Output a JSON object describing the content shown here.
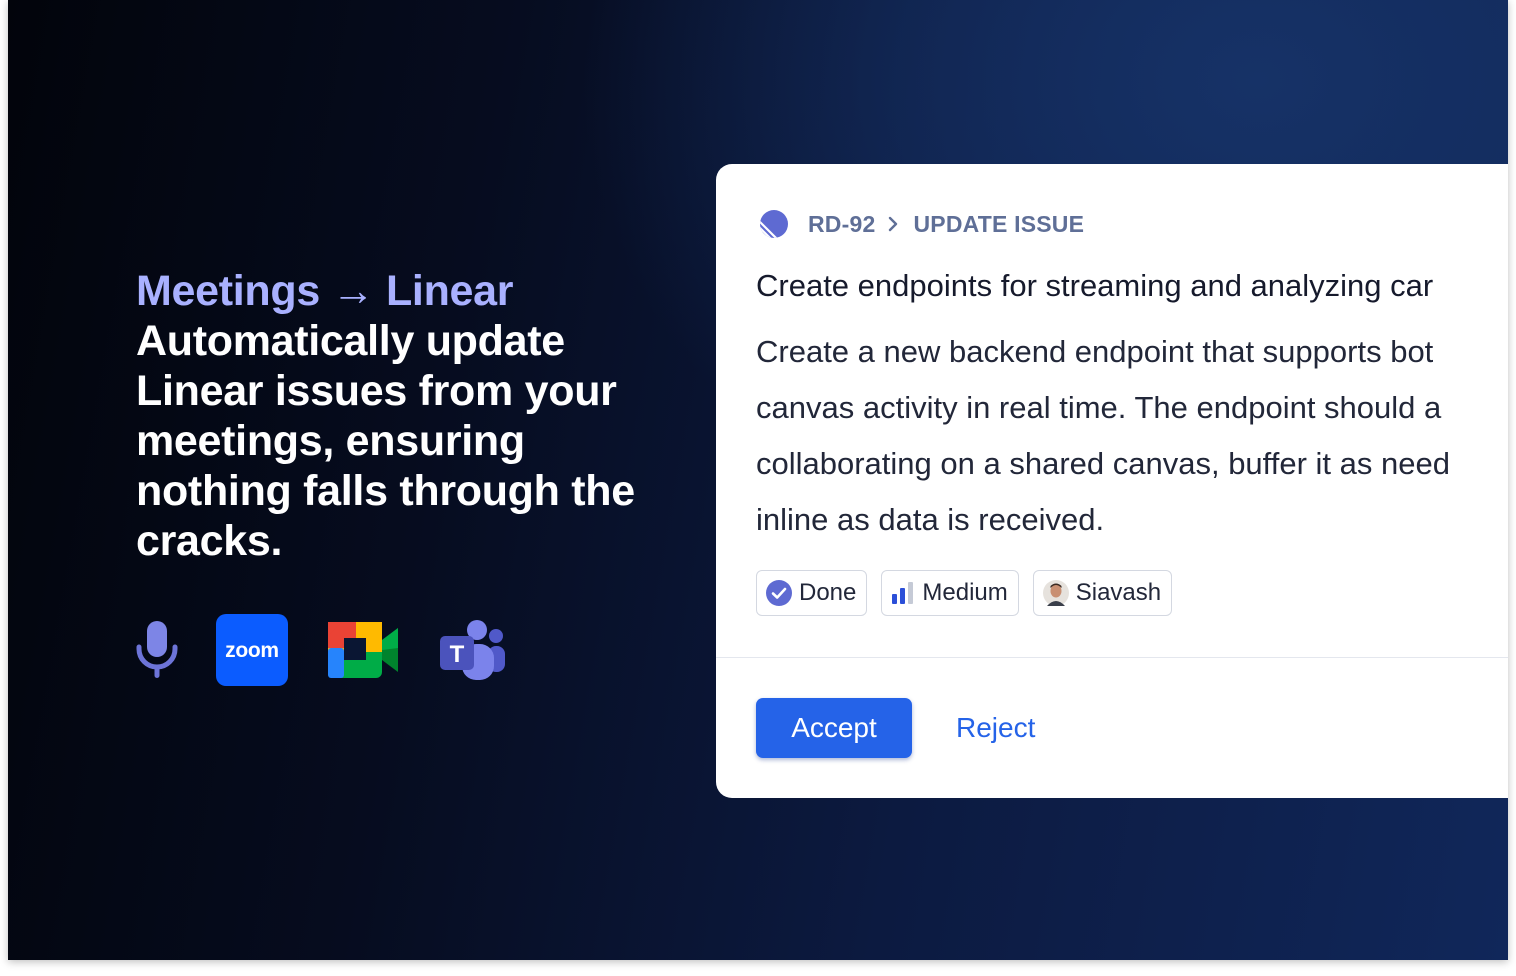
{
  "hero": {
    "accent_line": "Meetings → Linear",
    "headline": "Automatically update Linear issues from your meetings, ensuring nothing falls through the cracks."
  },
  "integrations": [
    {
      "name": "microphone-icon"
    },
    {
      "name": "zoom-icon",
      "label": "zoom"
    },
    {
      "name": "google-meet-icon"
    },
    {
      "name": "microsoft-teams-icon",
      "label": "T"
    }
  ],
  "issue_card": {
    "breadcrumb": {
      "issue_id": "RD-92",
      "action": "UPDATE ISSUE"
    },
    "title": "Create endpoints for streaming and analyzing car",
    "description_lines": [
      "Create a new backend endpoint that supports bot",
      "canvas activity in real time. The endpoint should a",
      "collaborating on a shared canvas, buffer it as need",
      "inline as data is received."
    ],
    "status": {
      "label": "Done",
      "icon": "check-circle-icon"
    },
    "priority": {
      "label": "Medium",
      "icon": "priority-bars-icon"
    },
    "assignee": {
      "label": "Siavash",
      "icon": "avatar"
    },
    "actions": {
      "accept_label": "Accept",
      "reject_label": "Reject"
    }
  },
  "colors": {
    "accent_text": "#a9b1ff",
    "primary_button": "#2563e8",
    "breadcrumb_text": "#5f6f97",
    "zoom_blue": "#0b5cff",
    "teams_purple": "#5b5fc7",
    "linear_logo": "#5e6ad2"
  }
}
